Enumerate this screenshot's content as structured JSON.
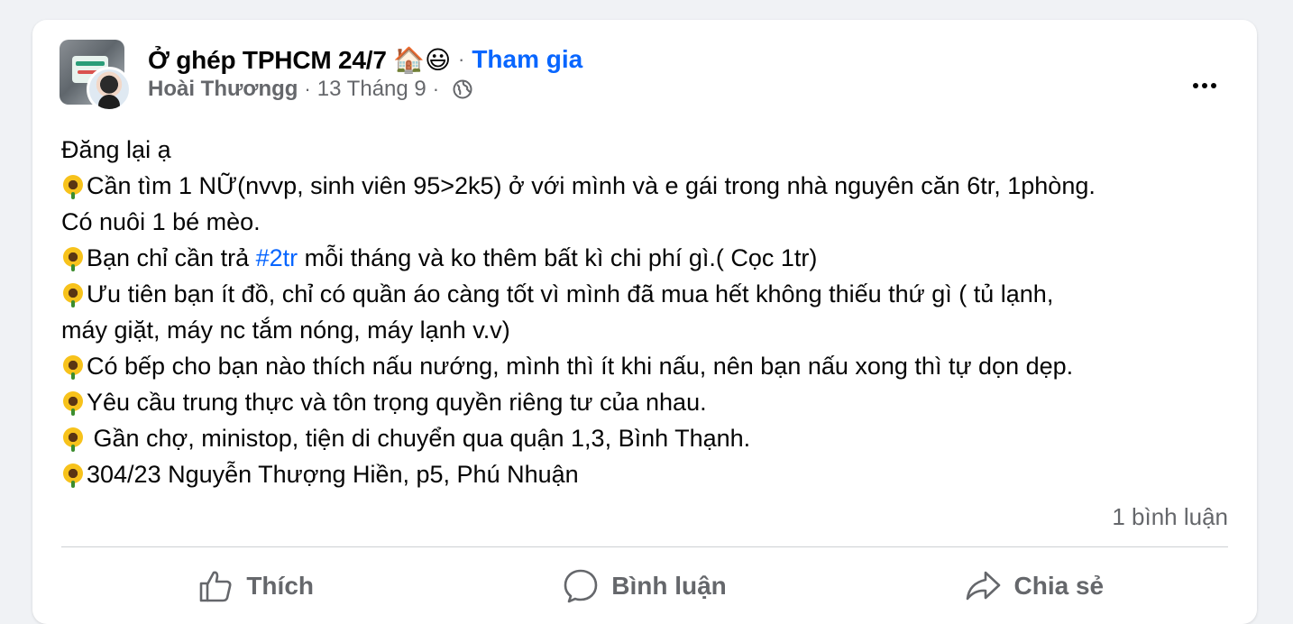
{
  "post": {
    "group_name": "Ở ghép TPHCM 24/7 🏠😃",
    "separator": "·",
    "join_label": "Tham gia",
    "author": "Hoài Thươngg",
    "date": "13 Tháng 9",
    "privacy_icon": "globe-icon",
    "menu_icon": "more-horizontal-icon"
  },
  "content": {
    "line1": "Đăng lại ạ",
    "line2": "Cần tìm 1 NỮ(nvvp, sinh viên 95>2k5) ở với mình và e gái trong nhà nguyên căn 6tr, 1phòng.",
    "line3": "Có nuôi 1 bé mèo.",
    "line4_pre": "Bạn chỉ cần trả ",
    "line4_hashtag": "#2tr",
    "line4_post": " mỗi tháng và ko thêm bất kì chi phí gì.( Cọc 1tr)",
    "line5": "Ưu tiên bạn ít đồ, chỉ có quần áo càng tốt vì mình đã mua hết không thiếu thứ gì ( tủ lạnh,",
    "line6": "máy giặt, máy nc tắm nóng, máy lạnh v.v)",
    "line7": "Có bếp cho bạn nào thích nấu nướng, mình thì ít khi nấu, nên bạn nấu xong thì tự dọn dẹp.",
    "line8": "Yêu cầu trung thực và tôn trọng quyền riêng tư của nhau.",
    "line9": " Gần chợ, ministop, tiện di chuyển qua quận 1,3, Bình Thạnh.",
    "line10": "304/23 Nguyễn Thượng Hiền, p5, Phú Nhuận",
    "bullet_icon": "sunflower-icon"
  },
  "stats": {
    "comments": "1 bình luận"
  },
  "actions": {
    "like": "Thích",
    "comment": "Bình luận",
    "share": "Chia sẻ"
  },
  "colors": {
    "background": "#f0f2f5",
    "card": "#ffffff",
    "link": "#0866ff",
    "secondary_text": "#65676b",
    "primary_text": "#050505"
  }
}
